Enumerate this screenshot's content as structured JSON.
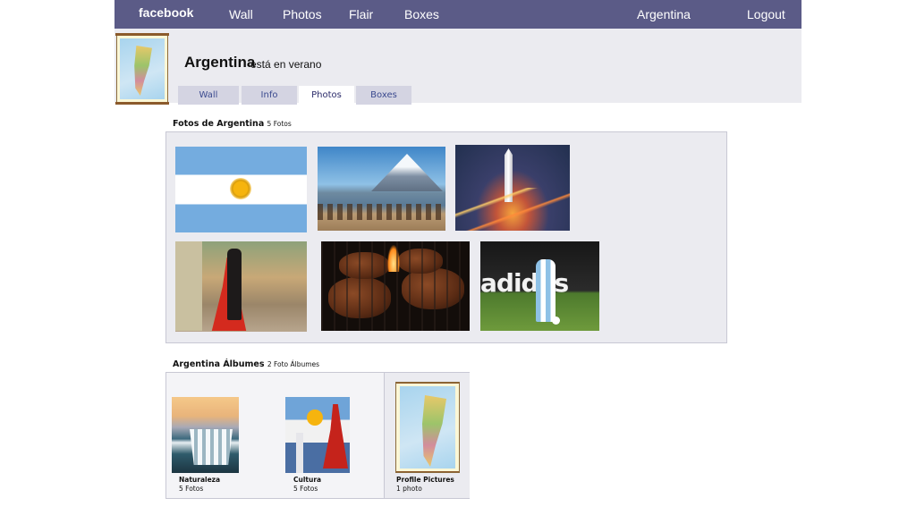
{
  "topbar": {
    "logo": "facebook",
    "nav": [
      "Wall",
      "Photos",
      "Flair",
      "Boxes"
    ],
    "profile_link": "Argentina",
    "logout": "Logout",
    "color": "#5b5b87"
  },
  "profile": {
    "name": "Argentina",
    "status": "está en verano",
    "avatar_icon": "argentina-map-icon"
  },
  "tabs": [
    {
      "label": "Wall",
      "active": false
    },
    {
      "label": "Info",
      "active": false
    },
    {
      "label": "Photos",
      "active": true
    },
    {
      "label": "Boxes",
      "active": false
    }
  ],
  "photos": {
    "title": "Fotos de Argentina",
    "count": "5 Fotos",
    "items": [
      "argentina-flag",
      "andes-gauchos",
      "buenos-aires-obelisk",
      "tango-dancers",
      "asado-grill",
      "soccer-player"
    ]
  },
  "albums": {
    "title": "Argentina Álbumes",
    "count": "2 Foto Álbumes",
    "items": [
      {
        "title": "Naturaleza",
        "count": "5 Fotos"
      },
      {
        "title": "Cultura",
        "count": "5 Fotos"
      },
      {
        "title": "Profile Pictures",
        "count": "1 photo"
      }
    ]
  }
}
